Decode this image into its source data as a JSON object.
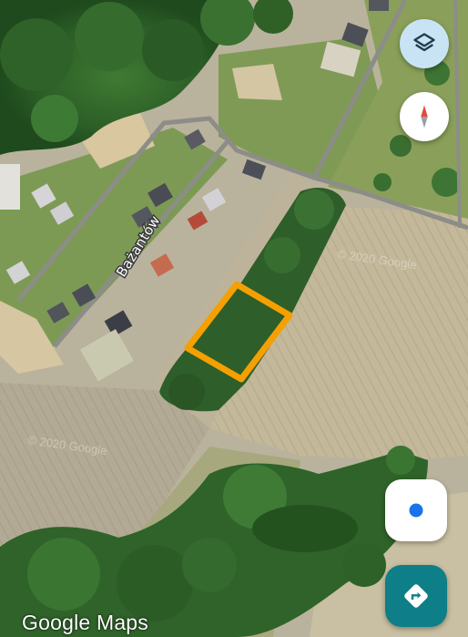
{
  "map": {
    "street_label": "Bażantów",
    "imagery_watermarks": [
      "© 2020 Google",
      "© 2020 Google"
    ],
    "brand": "Google Maps",
    "highlight_color": "#f5a000"
  },
  "controls": {
    "layers_icon": "layers-icon",
    "compass_icon": "compass-icon",
    "my_location_icon": "my-location-icon",
    "directions_icon": "directions-icon"
  },
  "colors": {
    "layers_button": "#c8e4f4",
    "location_dot": "#1a73e8",
    "directions_button": "#0e7e88"
  }
}
